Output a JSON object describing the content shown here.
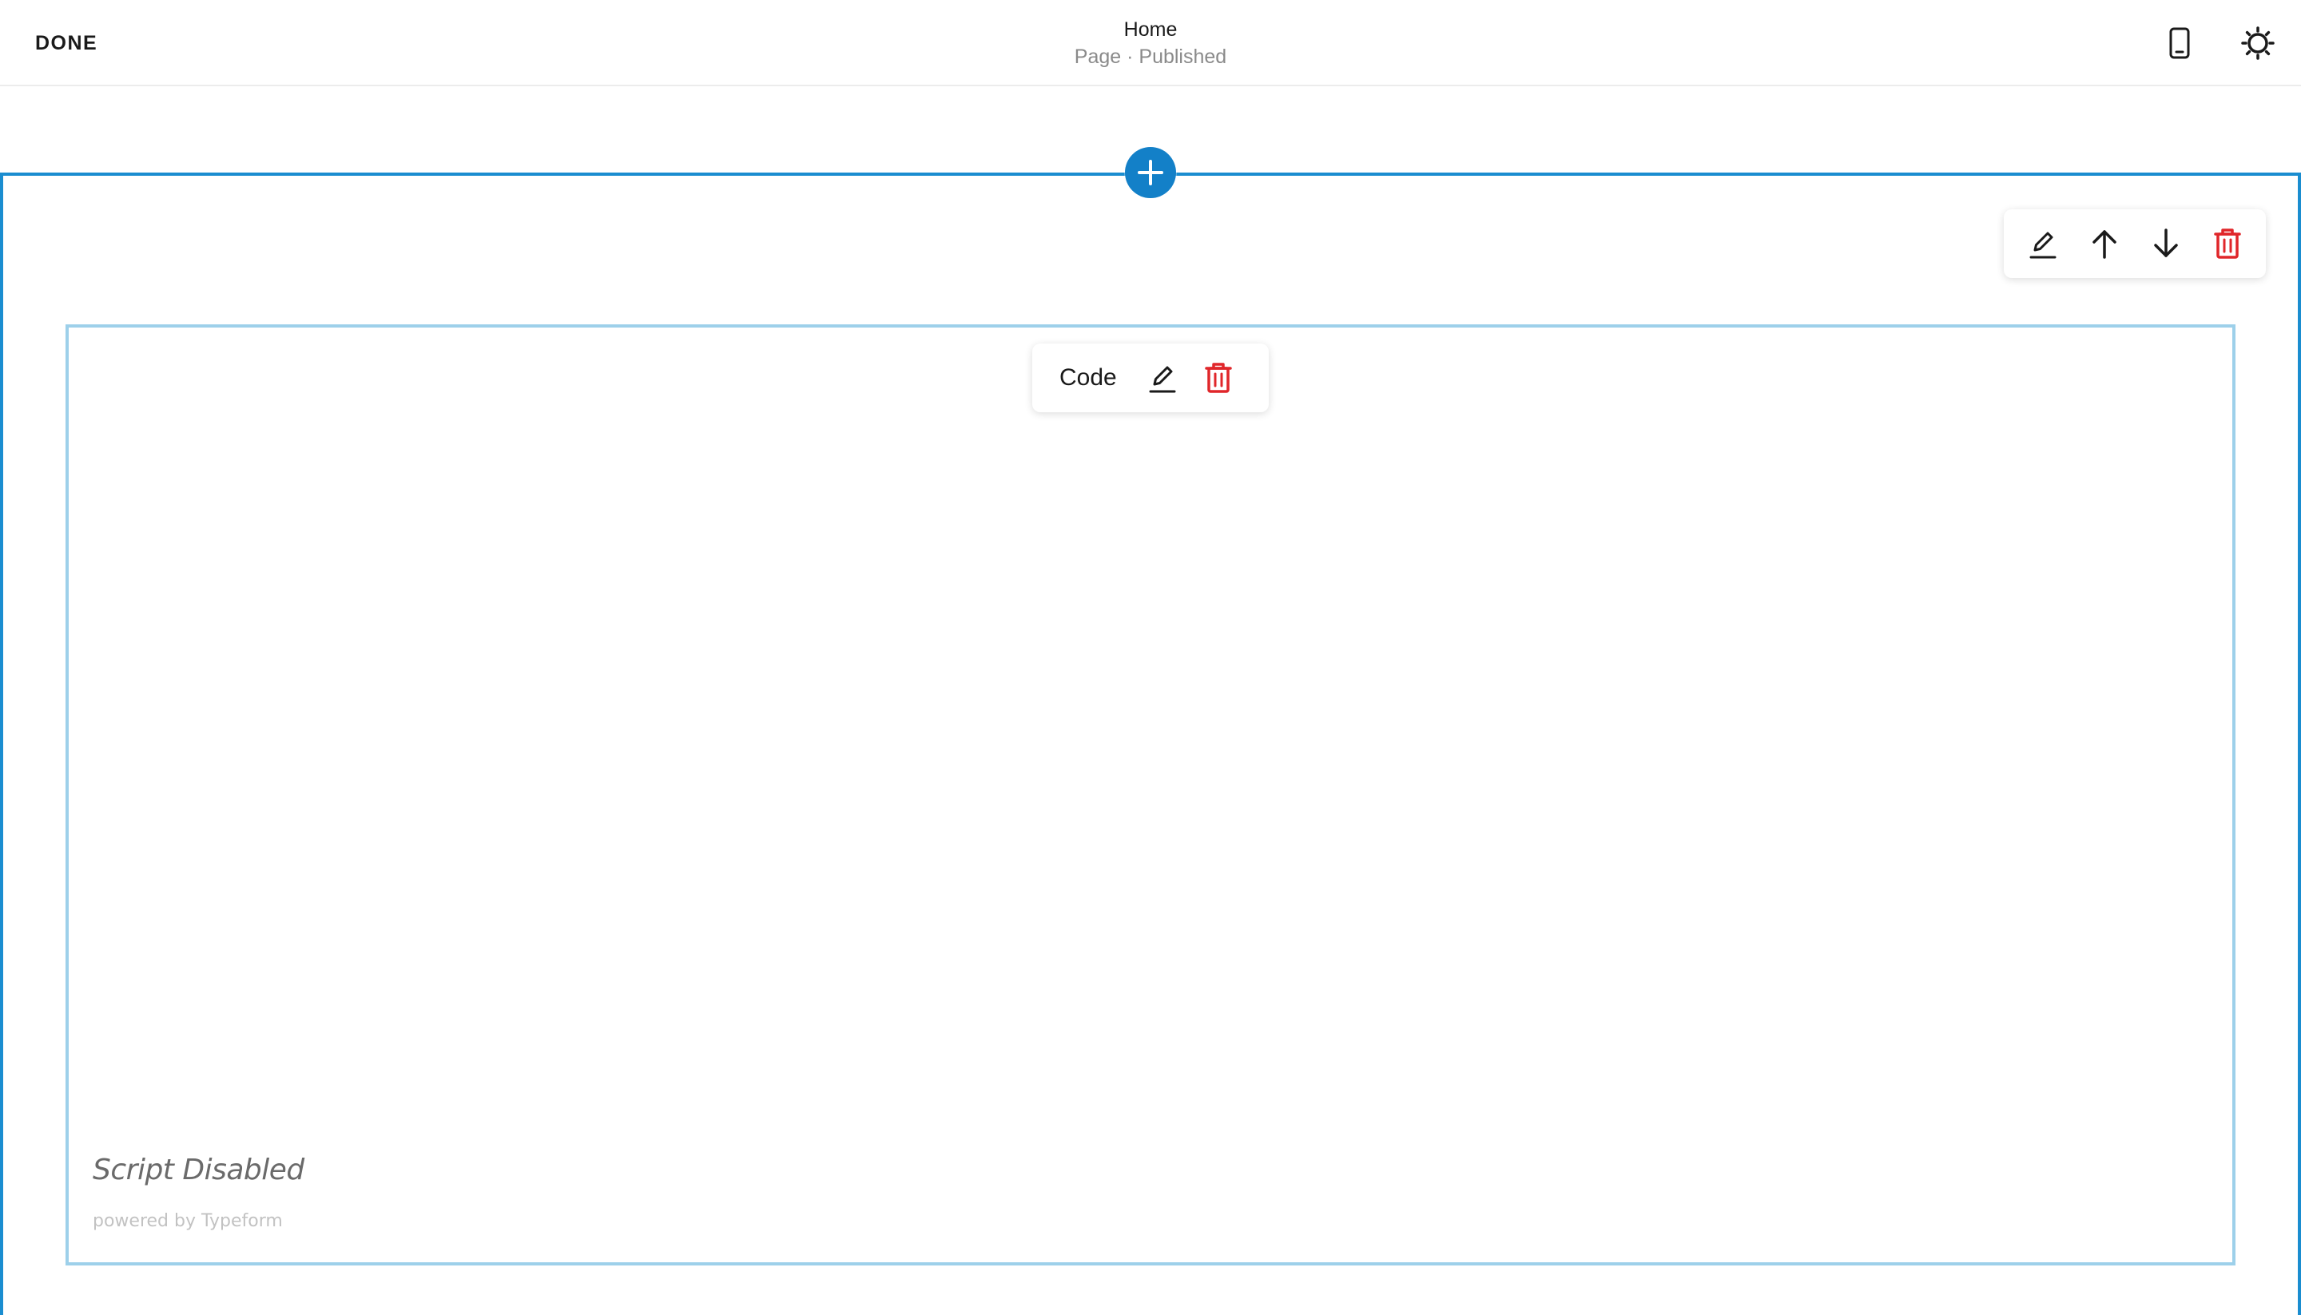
{
  "topbar": {
    "done_label": "DONE",
    "page_title": "Home",
    "page_status": "Page · Published",
    "mobile_icon": "mobile-phone-icon",
    "style_icon": "sun-icon"
  },
  "section": {
    "add_icon": "plus-icon",
    "toolbar": [
      "pencil-icon",
      "arrow-up-icon",
      "arrow-down-icon",
      "trash-icon"
    ]
  },
  "block": {
    "label": "Code",
    "toolbar": [
      "pencil-icon",
      "trash-icon"
    ],
    "embed_text": "Script Disabled",
    "powered_by": "powered by Typeform"
  },
  "colors": {
    "accent": "#1380c8",
    "section_border": "#1a8dd0",
    "block_border": "#9dd0ea",
    "delete_red": "#e0262a"
  }
}
